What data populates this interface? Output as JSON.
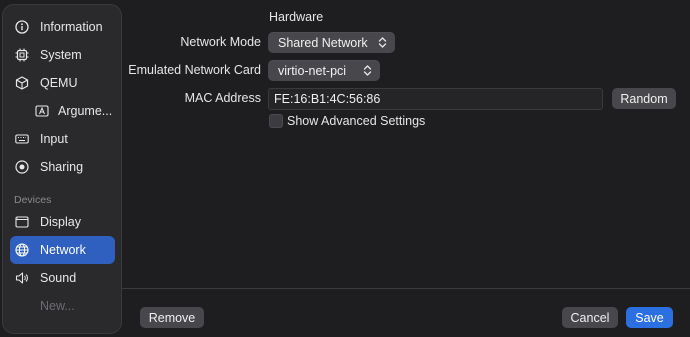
{
  "sidebar": {
    "items": [
      {
        "label": "Information",
        "icon": "info-icon"
      },
      {
        "label": "System",
        "icon": "cpu-icon"
      },
      {
        "label": "QEMU",
        "icon": "cube-icon"
      },
      {
        "label": "Argume...",
        "icon": "argument-icon"
      },
      {
        "label": "Input",
        "icon": "keyboard-icon"
      },
      {
        "label": "Sharing",
        "icon": "sharing-icon"
      }
    ],
    "devices_header": "Devices",
    "devices": [
      {
        "label": "Display",
        "icon": "display-icon"
      },
      {
        "label": "Network",
        "icon": "globe-icon",
        "selected": true
      },
      {
        "label": "Sound",
        "icon": "speaker-icon"
      },
      {
        "label": "New..."
      }
    ]
  },
  "form": {
    "section_title": "Hardware",
    "network_mode_label": "Network Mode",
    "network_mode_value": "Shared Network",
    "network_card_label": "Emulated Network Card",
    "network_card_value": "virtio-net-pci",
    "mac_label": "MAC Address",
    "mac_value": "FE:16:B1:4C:56:86",
    "random_label": "Random",
    "advanced_label": "Show Advanced Settings",
    "advanced_checked": false
  },
  "footer": {
    "remove_label": "Remove",
    "cancel_label": "Cancel",
    "save_label": "Save"
  },
  "colors": {
    "accent": "#2c6fe0",
    "selection": "#2f5fbf"
  }
}
